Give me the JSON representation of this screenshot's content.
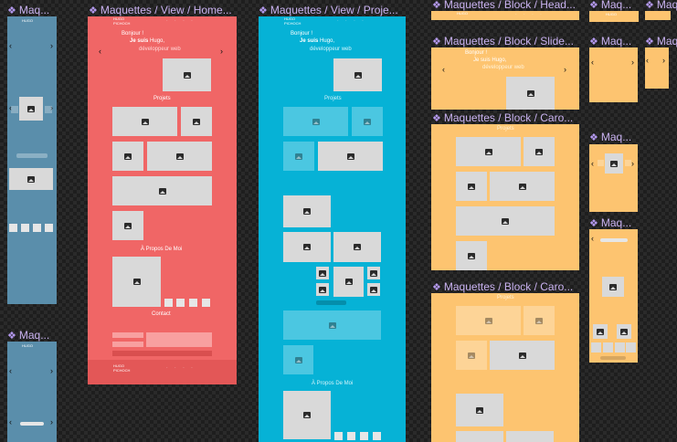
{
  "frames": [
    {
      "id": "view-home",
      "label": "Maquettes / View / Home..."
    },
    {
      "id": "view-projects",
      "label": "Maquettes / View / Proje..."
    },
    {
      "id": "block-header",
      "label": "Maquettes / Block / Head..."
    },
    {
      "id": "block-slider",
      "label": "Maquettes / Block / Slide..."
    },
    {
      "id": "block-carousel-1",
      "label": "Maquettes / Block / Caro..."
    },
    {
      "id": "block-carousel-2",
      "label": "Maquettes / Block / Caro..."
    },
    {
      "id": "left-1",
      "label": "Maq..."
    },
    {
      "id": "left-2",
      "label": "Maq..."
    },
    {
      "id": "right-1",
      "label": "Maq..."
    },
    {
      "id": "right-2",
      "label": "Maq..."
    },
    {
      "id": "right-3",
      "label": "Maq..."
    },
    {
      "id": "right-4",
      "label": "Maq..."
    },
    {
      "id": "right-5",
      "label": "Maq..."
    },
    {
      "id": "right-6",
      "label": "Maq..."
    }
  ],
  "glyph": "❖",
  "hero": {
    "greeting": "Bonjour !",
    "intro_prefix": "Je suis",
    "name": "Hugo,",
    "role": "développeur web"
  },
  "sections": {
    "projects": "Projets",
    "about": "À Propos De Moi",
    "contact": "Contact"
  },
  "logo": {
    "line1": "HUGO",
    "line2": "ROMAIN",
    "line3": "PICHOCH"
  },
  "arrows": {
    "left": "‹",
    "right": "›"
  },
  "icons": {
    "image": "image-placeholder-icon",
    "frame": "component-glyph-icon"
  },
  "colors": {
    "home_bg": "#f06666",
    "projects_bg": "#06b2d6",
    "block_bg": "#fdc470",
    "left_bg": "#5a8eab",
    "label": "#c9b2f0",
    "placeholder": "#d9d9d9"
  }
}
